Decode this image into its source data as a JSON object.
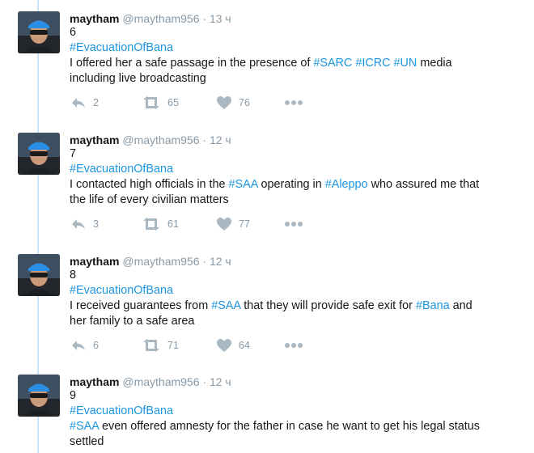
{
  "colors": {
    "hashtag": "#1b95e0",
    "meta": "#8899a6",
    "thread_line": "#cce4f6",
    "text": "#14171a"
  },
  "icons": {
    "reply": "reply-icon",
    "retweet": "retweet-icon",
    "like": "heart-icon",
    "more": "more-dots-icon"
  },
  "tweets": [
    {
      "name": "maytham",
      "handle": "@maytham956",
      "sep": "·",
      "time": "13 ч",
      "number": "6",
      "hashtag": "#EvacuationOfBana",
      "text_a1": "I offered her a safe passage in the presence of ",
      "tag_a1": "#SARC",
      "text_a2": " ",
      "tag_a2": "#ICRC",
      "text_a3": " ",
      "tag_a3": "#UN",
      "text_a4": " media",
      "line2": "including live broadcasting",
      "replies": "2",
      "retweets": "65",
      "likes": "76"
    },
    {
      "name": "maytham",
      "handle": "@maytham956",
      "sep": "·",
      "time": "12 ч",
      "number": "7",
      "hashtag": "#EvacuationOfBana",
      "text_a1": "I contacted high officials in the ",
      "tag_a1": "#SAA",
      "text_a2": " operating in ",
      "tag_a2": "#Aleppo",
      "text_a3": " who assured me that",
      "line2": "the life of every civilian matters",
      "replies": "3",
      "retweets": "61",
      "likes": "77"
    },
    {
      "name": "maytham",
      "handle": "@maytham956",
      "sep": "·",
      "time": "12 ч",
      "number": "8",
      "hashtag": "#EvacuationOfBana",
      "text_a1": "I received guarantees from ",
      "tag_a1": "#SAA",
      "text_a2": " that they will provide safe exit for ",
      "tag_a2": "#Bana",
      "text_a3": " and",
      "line2": "her family to a safe area",
      "replies": "6",
      "retweets": "71",
      "likes": "64"
    },
    {
      "name": "maytham",
      "handle": "@maytham956",
      "sep": "·",
      "time": "12 ч",
      "number": "9",
      "hashtag": "#EvacuationOfBana",
      "tag_a1": "#SAA",
      "text_a2": " even offered amnesty for the father in case he want to get his legal status",
      "line2": "settled"
    }
  ]
}
